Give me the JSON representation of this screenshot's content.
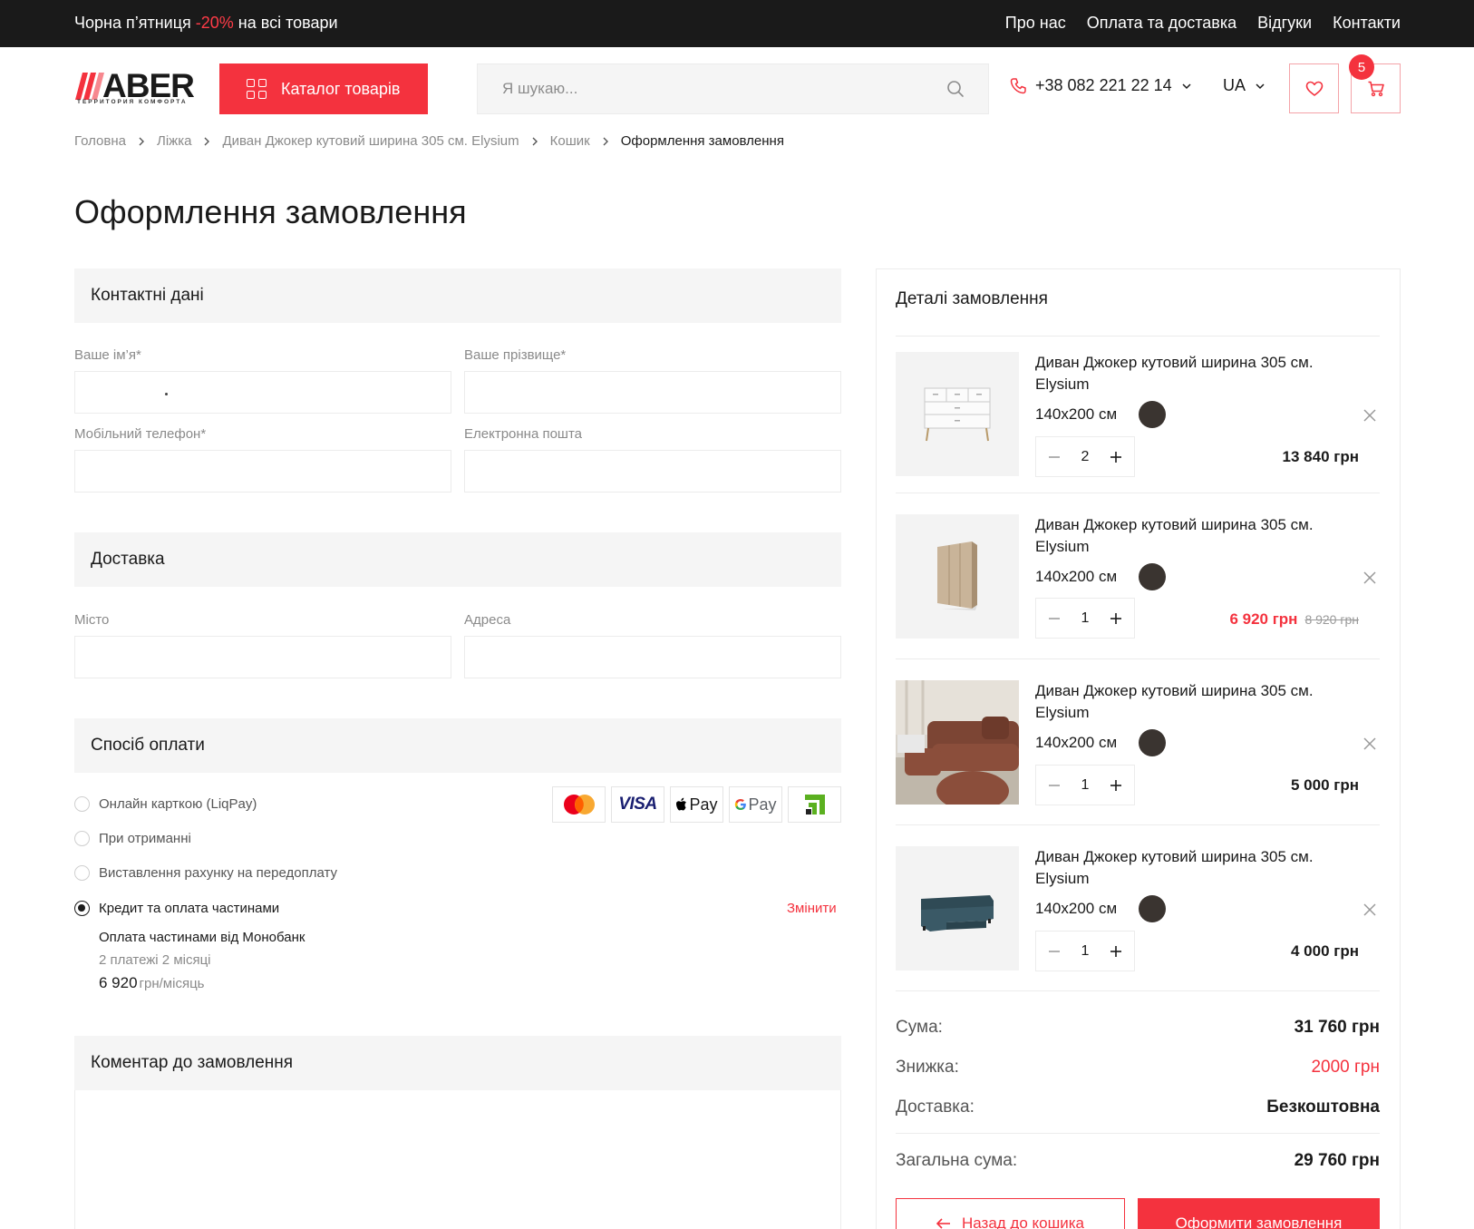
{
  "topbar": {
    "promo_before": "Чорна п’ятниця ",
    "promo_accent": "-20%",
    "promo_after": " на всі товари",
    "nav": [
      "Про нас",
      "Оплата та доставка",
      "Відгуки",
      "Контакти"
    ]
  },
  "header": {
    "logo_text": "ABER",
    "logo_tagline": "ТЕРРИТОРИЯ КОМФОРТА",
    "catalog_label": "Каталог товарів",
    "search_placeholder": "Я шукаю...",
    "phone": "+38 082 221 22 14",
    "language": "UA",
    "cart_count": "5"
  },
  "breadcrumb": [
    "Головна",
    "Ліжка",
    "Диван Джокер кутовий ширина 305 см. Elysium",
    "Кошик",
    "Оформлення замовлення"
  ],
  "page_title": "Оформлення замовлення",
  "contacts": {
    "heading": "Контактні дані",
    "first_name_label": "Ваше ім’я*",
    "last_name_label": "Ваше прізвище*",
    "phone_label": "Мобільний телефон*",
    "email_label": "Електронна пошта"
  },
  "delivery": {
    "heading": "Доставка",
    "city_label": "Місто",
    "address_label": "Адреса"
  },
  "payment": {
    "heading": "Спосіб оплати",
    "options": [
      {
        "label": "Онлайн карткою (LiqPay)",
        "selected": false
      },
      {
        "label": "При отриманні",
        "selected": false
      },
      {
        "label": "Виставлення рахунку на передоплату",
        "selected": false
      },
      {
        "label": "Кредит та оплата частинами",
        "selected": true
      }
    ],
    "change_label": "Змінити",
    "credit_title": "Оплата частинами від Монобанк",
    "credit_terms": "2 платежі 2 місяці",
    "credit_amount": "6 920",
    "credit_unit": "грн/місяць",
    "logos": [
      "mastercard-logo",
      "visa-logo",
      "apple-pay-logo",
      "google-pay-logo",
      "privatbank-logo"
    ],
    "visa_text": "VISA",
    "apple_pay_text": "Pay",
    "google_pay_text": "Pay"
  },
  "comment": {
    "heading": "Коментар до замовлення"
  },
  "order": {
    "heading": "Деталі замовлення",
    "items": [
      {
        "name": "Диван Джокер кутовий ширина 305 см. Elysium",
        "size": "140x200 см",
        "qty": "2",
        "price": "13 840 грн",
        "old_price": "",
        "image": "white-dresser-image"
      },
      {
        "name": "Диван Джокер кутовий ширина 305 см. Elysium",
        "size": "140x200 см",
        "qty": "1",
        "price": "6 920 грн",
        "old_price": "8 920 грн",
        "image": "wardrobe-image"
      },
      {
        "name": "Диван Джокер кутовий ширина 305 см. Elysium",
        "size": "140x200 см",
        "qty": "1",
        "price": "5 000 грн",
        "old_price": "",
        "image": "brown-sofa-image"
      },
      {
        "name": "Диван Джокер кутовий ширина 305 см. Elysium",
        "size": "140x200 см",
        "qty": "1",
        "price": "4 000 грн",
        "old_price": "",
        "image": "teal-corner-sofa-image"
      }
    ],
    "summary": {
      "sum_label": "Сума:",
      "sum_value": "31 760 грн",
      "discount_label": "Знижка:",
      "discount_value": "2000 грн",
      "delivery_label": "Доставка:",
      "delivery_value": "Безкоштовна",
      "total_label": "Загальна сума:",
      "total_value": "29 760 грн"
    },
    "back_label": "Назад до кошика",
    "submit_label": "Оформити замовлення"
  },
  "colors": {
    "accent": "#f4323e",
    "dark": "#1a1a1a",
    "swatch": "#3a3430"
  }
}
